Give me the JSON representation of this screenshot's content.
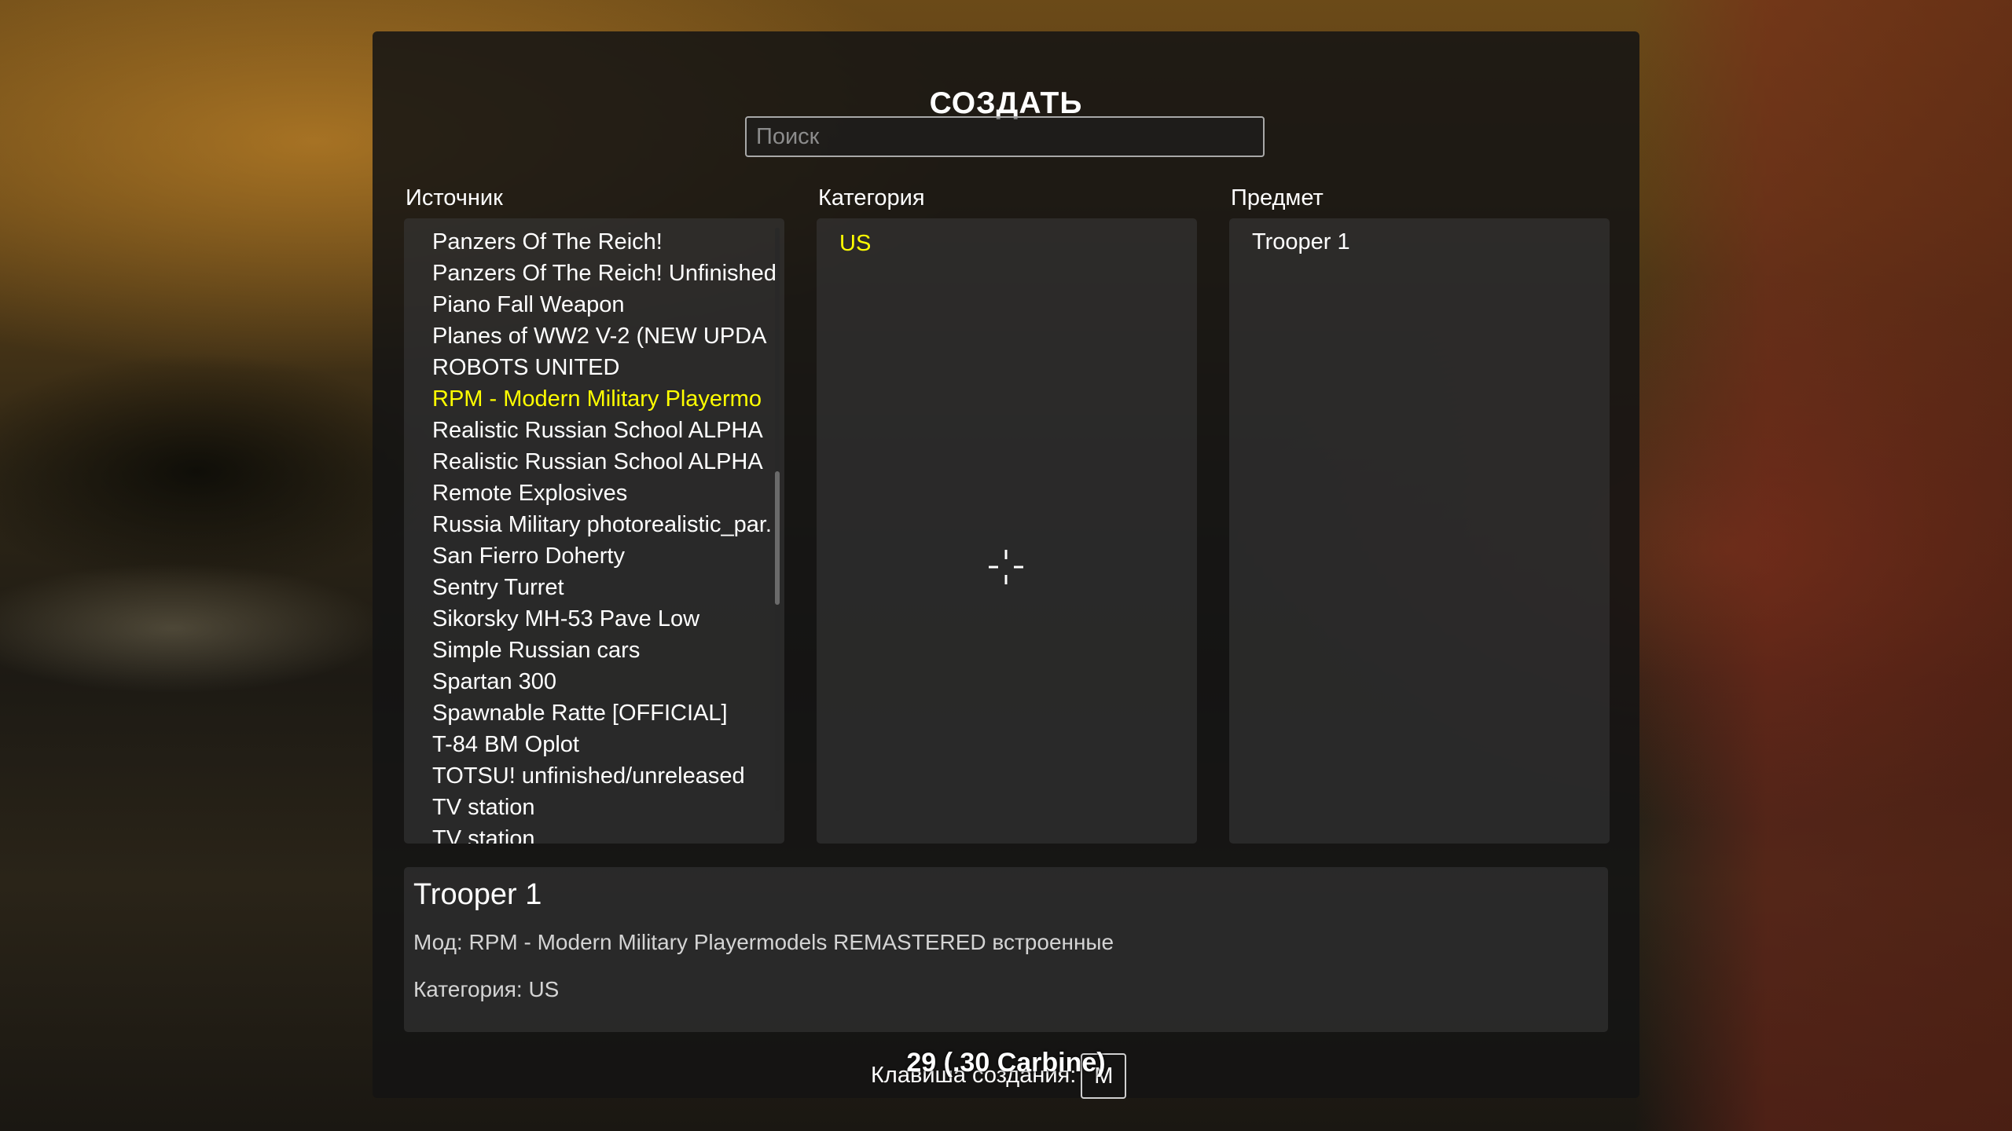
{
  "menu": {
    "title": "СОЗДАТЬ",
    "search_placeholder": "Поиск",
    "search_value": ""
  },
  "columns": {
    "source_label": "Источник",
    "category_label": "Категория",
    "item_label": "Предмет"
  },
  "source": {
    "items": [
      "Panzers Of The Reich!",
      "Panzers Of The Reich! Unfinished",
      "Piano Fall Weapon",
      "Planes of WW2 V-2 (NEW UPDA",
      "ROBOTS UNITED",
      "RPM - Modern Military Playermo",
      "Realistic Russian School ALPHA",
      "Realistic Russian School ALPHA",
      "Remote Explosives",
      "Russia Military photorealistic_par.",
      "San Fierro Doherty",
      "Sentry Turret",
      "Sikorsky MH-53 Pave Low",
      "Simple Russian cars",
      "Spartan 300",
      "Spawnable Ratte [OFFICIAL]",
      "T-84 BM Oplot",
      "TOTSU! unfinished/unreleased",
      "TV station",
      "TV station"
    ],
    "selected_index": 5
  },
  "category": {
    "items": [
      "US"
    ],
    "selected_index": 0
  },
  "item": {
    "items": [
      "Trooper 1"
    ]
  },
  "details": {
    "name": "Trooper 1",
    "mod": "Мод: RPM - Modern Military Playermodels REMASTERED встроенные",
    "category": "Категория: US"
  },
  "footer": {
    "craft_key_label": "Клавиша создания:",
    "craft_key": "M"
  },
  "hud": {
    "ammo": "29 (.30 Carbine)",
    "crosshair_icon": "crosshair-icon"
  },
  "colors": {
    "selected": "#ffff00",
    "text": "#ffffff"
  }
}
